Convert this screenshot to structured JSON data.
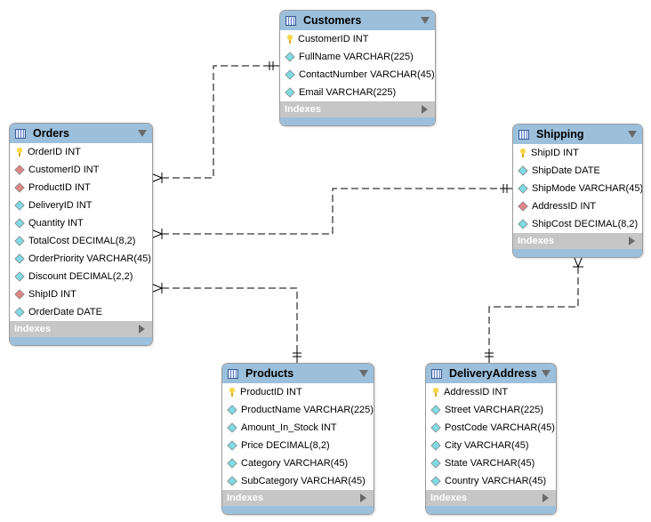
{
  "colors": {
    "header": "#9cc0dc",
    "pk": "#f6d84a",
    "fk": "#e08585",
    "column": "#7fdbe4",
    "indexes": "#c6c6c6"
  },
  "tables": {
    "customers": {
      "name": "Customers",
      "indexes": "Indexes",
      "columns": [
        {
          "label": "CustomerID INT",
          "kind": "pk"
        },
        {
          "label": "FullName VARCHAR(225)",
          "kind": "col"
        },
        {
          "label": "ContactNumber VARCHAR(45)",
          "kind": "col"
        },
        {
          "label": "Email VARCHAR(225)",
          "kind": "col"
        }
      ]
    },
    "orders": {
      "name": "Orders",
      "indexes": "Indexes",
      "columns": [
        {
          "label": "OrderID INT",
          "kind": "pk"
        },
        {
          "label": "CustomerID INT",
          "kind": "fk"
        },
        {
          "label": "ProductID INT",
          "kind": "fk"
        },
        {
          "label": "DeliveryID INT",
          "kind": "col"
        },
        {
          "label": "Quantity INT",
          "kind": "col"
        },
        {
          "label": "TotalCost DECIMAL(8,2)",
          "kind": "col"
        },
        {
          "label": "OrderPriority VARCHAR(45)",
          "kind": "col"
        },
        {
          "label": "Discount DECIMAL(2,2)",
          "kind": "col"
        },
        {
          "label": "ShipID INT",
          "kind": "fk"
        },
        {
          "label": "OrderDate DATE",
          "kind": "col"
        }
      ]
    },
    "shipping": {
      "name": "Shipping",
      "indexes": "Indexes",
      "columns": [
        {
          "label": "ShipID INT",
          "kind": "pk"
        },
        {
          "label": "ShipDate DATE",
          "kind": "col"
        },
        {
          "label": "ShipMode VARCHAR(45)",
          "kind": "col"
        },
        {
          "label": "AddressID INT",
          "kind": "fk"
        },
        {
          "label": "ShipCost DECIMAL(8,2)",
          "kind": "col"
        }
      ]
    },
    "products": {
      "name": "Products",
      "indexes": "Indexes",
      "columns": [
        {
          "label": "ProductID INT",
          "kind": "pk"
        },
        {
          "label": "ProductName VARCHAR(225)",
          "kind": "col"
        },
        {
          "label": "Amount_In_Stock INT",
          "kind": "col"
        },
        {
          "label": "Price DECIMAL(8,2)",
          "kind": "col"
        },
        {
          "label": "Category VARCHAR(45)",
          "kind": "col"
        },
        {
          "label": "SubCategory VARCHAR(45)",
          "kind": "col"
        }
      ]
    },
    "deliveryaddress": {
      "name": "DeliveryAddress",
      "indexes": "Indexes",
      "columns": [
        {
          "label": "AddressID INT",
          "kind": "pk"
        },
        {
          "label": "Street VARCHAR(225)",
          "kind": "col"
        },
        {
          "label": "PostCode VARCHAR(45)",
          "kind": "col"
        },
        {
          "label": "City VARCHAR(45)",
          "kind": "col"
        },
        {
          "label": "State VARCHAR(45)",
          "kind": "col"
        },
        {
          "label": "Country VARCHAR(45)",
          "kind": "col"
        }
      ]
    }
  },
  "relationships": [
    {
      "from": "orders",
      "to": "customers",
      "type": "many-to-one"
    },
    {
      "from": "orders",
      "to": "shipping",
      "type": "many-to-one"
    },
    {
      "from": "orders",
      "to": "products",
      "type": "many-to-one"
    },
    {
      "from": "shipping",
      "to": "deliveryaddress",
      "type": "many-to-one"
    }
  ]
}
